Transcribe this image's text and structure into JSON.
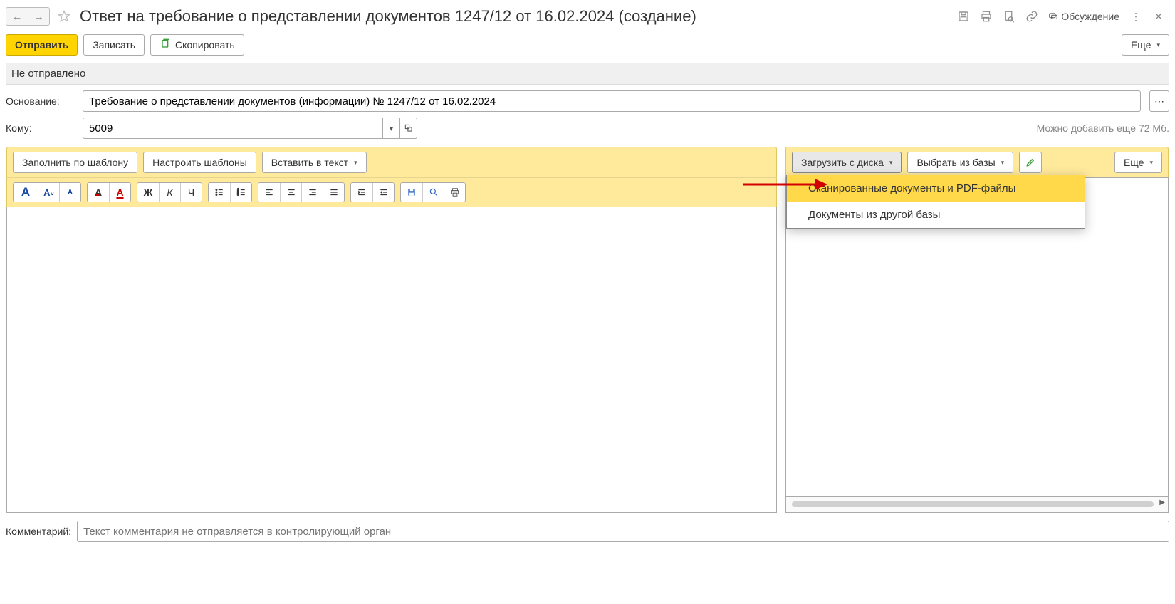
{
  "header": {
    "title": "Ответ на требование о представлении документов 1247/12 от 16.02.2024 (создание)",
    "discussion": "Обсуждение"
  },
  "cmd": {
    "send": "Отправить",
    "save": "Записать",
    "copy": "Скопировать",
    "more": "Еще"
  },
  "status": "Не отправлено",
  "form": {
    "basis_label": "Основание:",
    "basis_value": "Требование о представлении документов (информации) № 1247/12 от 16.02.2024",
    "to_label": "Кому:",
    "to_value": "5009",
    "size_hint": "Можно добавить еще 72 Мб."
  },
  "left_toolbar": {
    "fill_template": "Заполнить по шаблону",
    "setup_templates": "Настроить шаблоны",
    "insert_text": "Вставить в текст"
  },
  "right_toolbar": {
    "load_disk": "Загрузить с диска",
    "choose_base": "Выбрать из базы",
    "more": "Еще"
  },
  "dropdown": {
    "scanned_pdf": "Сканированные документы и PDF-файлы",
    "other_base": "Документы из другой базы"
  },
  "comment": {
    "label": "Комментарий:",
    "placeholder": "Текст комментария не отправляется в контролирующий орган"
  }
}
